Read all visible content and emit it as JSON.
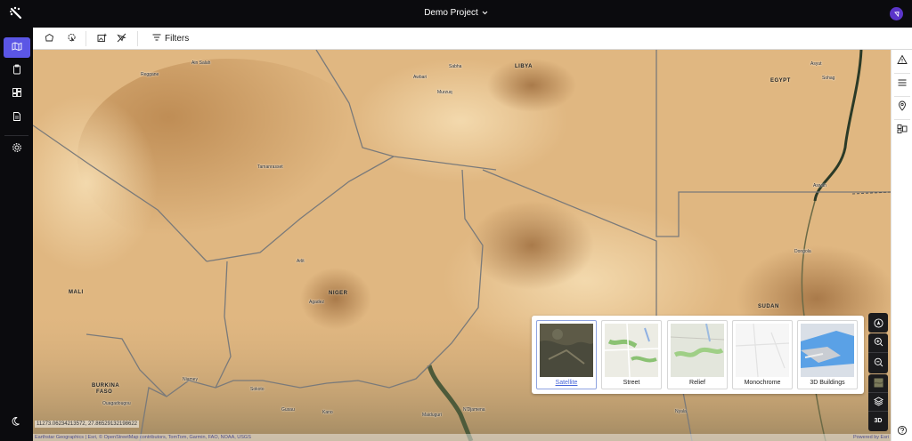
{
  "header": {
    "project_title": "Demo Project"
  },
  "toolbar": {
    "filters_label": "Filters"
  },
  "map": {
    "coordinates": "11273.06234213572, 27.86529132198622",
    "attribution": "Earthstar Geographics | Esri, © OpenStreetMap contributors, TomTom, Garmin, FAO, NOAA, USGS",
    "powered_by": "Powered by Esri",
    "countries": {
      "libya": "LIBYA",
      "egypt": "EGYPT",
      "mali": "MALI",
      "niger": "NIGER",
      "sudan": "SUDAN",
      "burkina": "BURKINA",
      "faso": "FASO"
    },
    "places": {
      "reggane": "Reggane",
      "ain_salah": "Ain Salah",
      "sabha": "Sabha",
      "awbari": "Awbari",
      "murzuq": "Murzuq",
      "asyut": "Asyut",
      "sohag": "Sohag",
      "tamanrasset": "Tamanrasset",
      "aswan": "Aswan",
      "dongola": "Dongola",
      "arlit": "Arlit",
      "agadez": "Agadez",
      "niamey": "Niamey",
      "ouagadougou": "Ouagadougou",
      "sokoto": "Sokoto",
      "gusau": "Gusau",
      "kano": "Kano",
      "maiduguri": "Maiduguri",
      "ndjamena": "N'Djamena",
      "nyala": "Nyala"
    }
  },
  "basemaps": [
    {
      "label": "Satellite",
      "active": true
    },
    {
      "label": "Street",
      "active": false
    },
    {
      "label": "Relief",
      "active": false
    },
    {
      "label": "Monochrome",
      "active": false
    },
    {
      "label": "3D Buildings",
      "active": false
    }
  ],
  "map_controls": {
    "three_d_label": "3D"
  },
  "colors": {
    "accent": "#5b56e5",
    "sidebar": "#0b0b0e",
    "avatar": "#5b35c9"
  }
}
